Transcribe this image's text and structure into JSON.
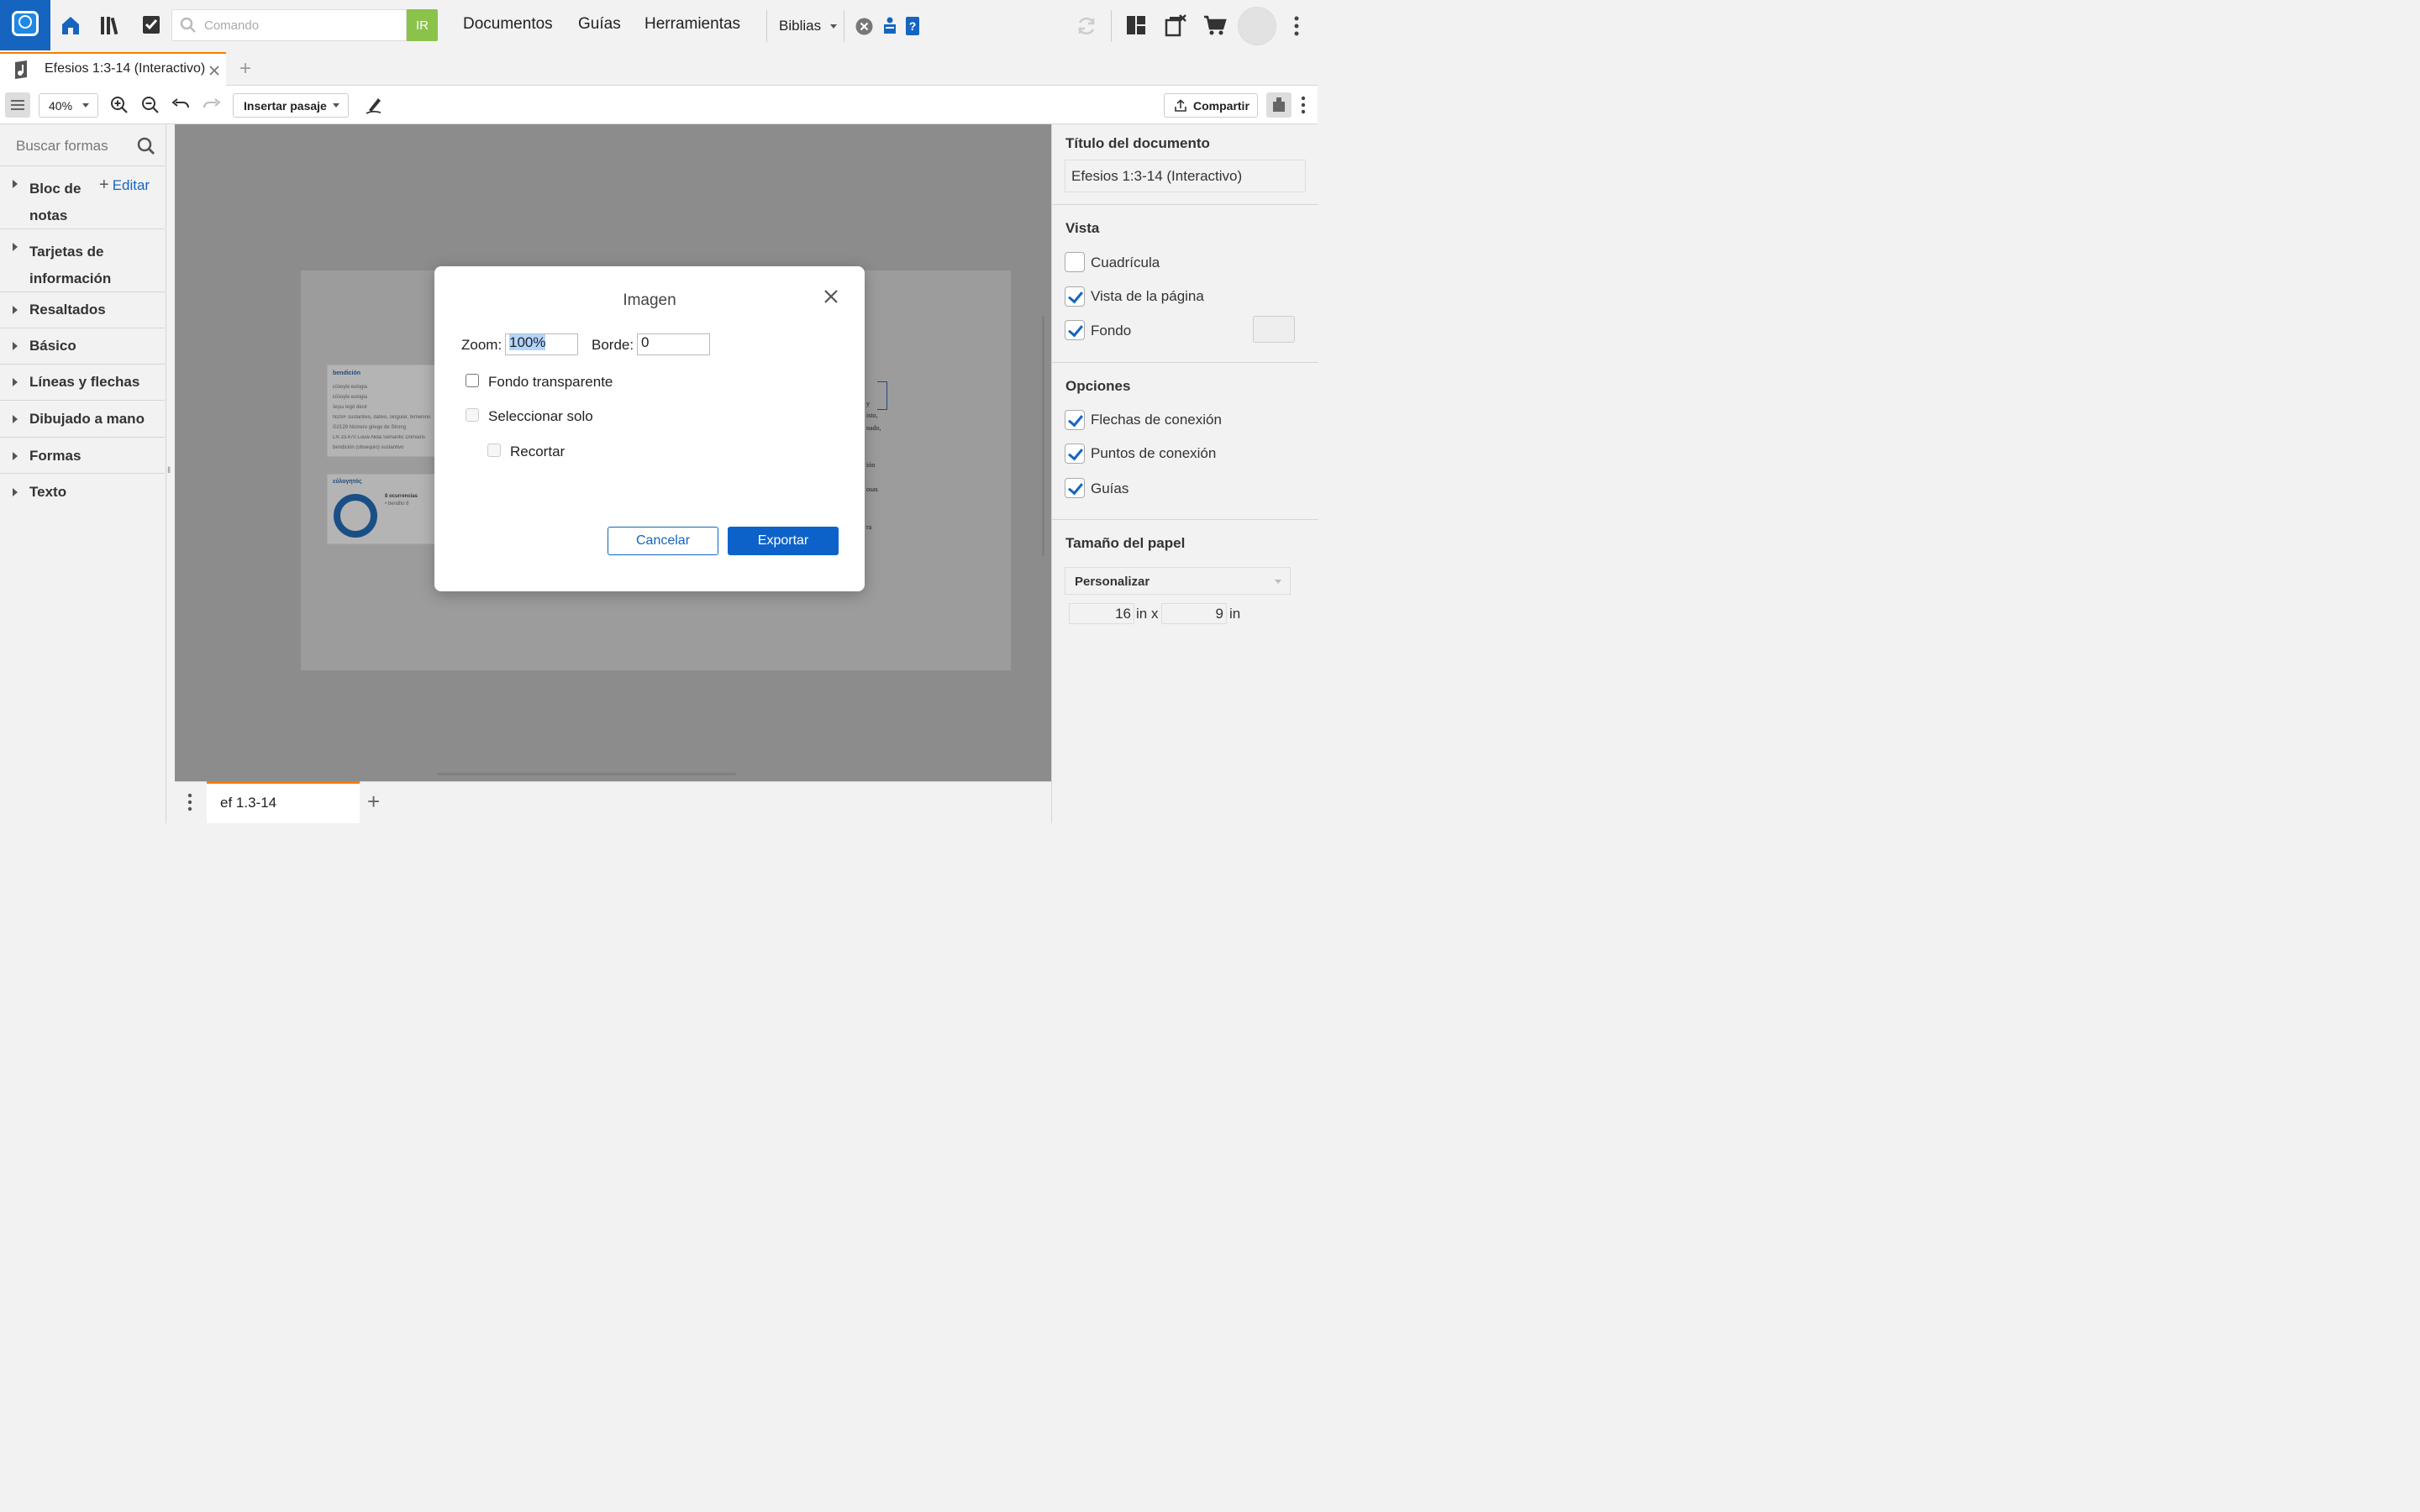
{
  "topbar": {
    "command_placeholder": "Comando",
    "go_label": "IR",
    "nav": [
      "Documentos",
      "Guías",
      "Herramientas"
    ],
    "bibles_label": "Biblias"
  },
  "tabs": {
    "active_label": "Efesios 1:3-14 (Interactivo)",
    "add_label": "+"
  },
  "toolbar": {
    "zoom_value": "40%",
    "insert_passage_label": "Insertar pasaje",
    "share_label": "Compartir"
  },
  "left_panel": {
    "search_placeholder": "Buscar formas",
    "edit_label": "Editar",
    "sections": [
      "Bloc de notas",
      "Tarjetas de información",
      "Resaltados",
      "Básico",
      "Líneas y flechas",
      "Dibujado a mano",
      "Formas",
      "Texto"
    ]
  },
  "canvas_cards": {
    "card1_title": "bendición",
    "card1_lines": [
      "εὐλογία eulogia",
      "εὐλογία eulogia",
      "λεγω legó decir",
      "NDSF sustantivo, dativo, singular, femenino",
      "G2129 Número griego de Strong",
      "LN 33.470 Louw-Nida Semantic Domains",
      "bendición (obsequio) sustantivo"
    ],
    "card2_title": "εὐλογητός",
    "card2_lines": [
      "8 ocurrencias",
      "• bendito 8"
    ],
    "page_text": [
      "y",
      "isto,",
      "nado,",
      "ión",
      "osas",
      "ra"
    ]
  },
  "bottombar": {
    "sheet_tab": "ef 1.3-14",
    "add_label": "+"
  },
  "right_panel": {
    "doc_title_heading": "Título del documento",
    "doc_title_value": "Efesios 1:3-14 (Interactivo)",
    "view_heading": "Vista",
    "view_options": [
      {
        "label": "Cuadrícula",
        "checked": false
      },
      {
        "label": "Vista de la página",
        "checked": true
      },
      {
        "label": "Fondo",
        "checked": true
      }
    ],
    "options_heading": "Opciones",
    "options": [
      {
        "label": "Flechas de conexión",
        "checked": true
      },
      {
        "label": "Puntos de conexión",
        "checked": true
      },
      {
        "label": "Guías",
        "checked": true
      }
    ],
    "paper_heading": "Tamaño del papel",
    "paper_preset": "Personalizar",
    "paper_width": "16",
    "paper_height": "9",
    "unit_x": "in x",
    "unit": "in"
  },
  "modal": {
    "title": "Imagen",
    "zoom_label": "Zoom:",
    "zoom_value": "100%",
    "border_label": "Borde:",
    "border_value": "0",
    "transparent_label": "Fondo transparente",
    "select_only_label": "Seleccionar solo",
    "crop_label": "Recortar",
    "cancel_label": "Cancelar",
    "export_label": "Exportar"
  },
  "colors": {
    "brand_blue": "#1565c0",
    "go_green": "#8bc34a",
    "tab_accent": "#f57c00",
    "export_blue": "#0d62c9"
  }
}
